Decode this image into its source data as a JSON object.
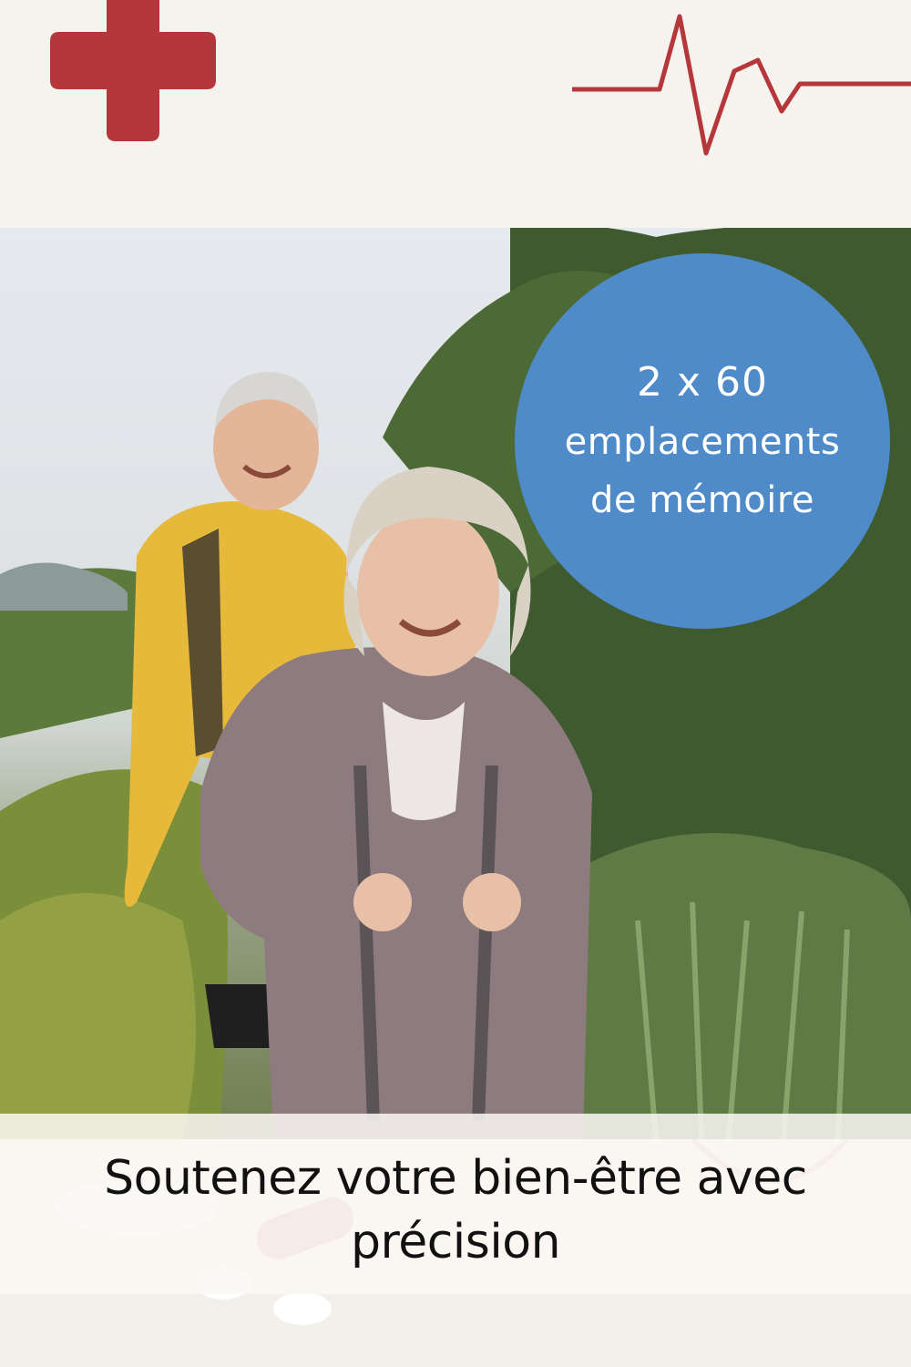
{
  "badge": {
    "line1": "2 x 60",
    "line2": "emplacements",
    "line3": "de mémoire"
  },
  "caption": {
    "line1": "Soutenez votre bien-être avec",
    "line2": "précision"
  },
  "colors": {
    "accent_red": "#b5363b",
    "badge_blue": "#4f8bc8",
    "background": "#f6f3ee"
  },
  "icons": [
    "medical-cross-icon",
    "heartbeat-line-icon"
  ]
}
